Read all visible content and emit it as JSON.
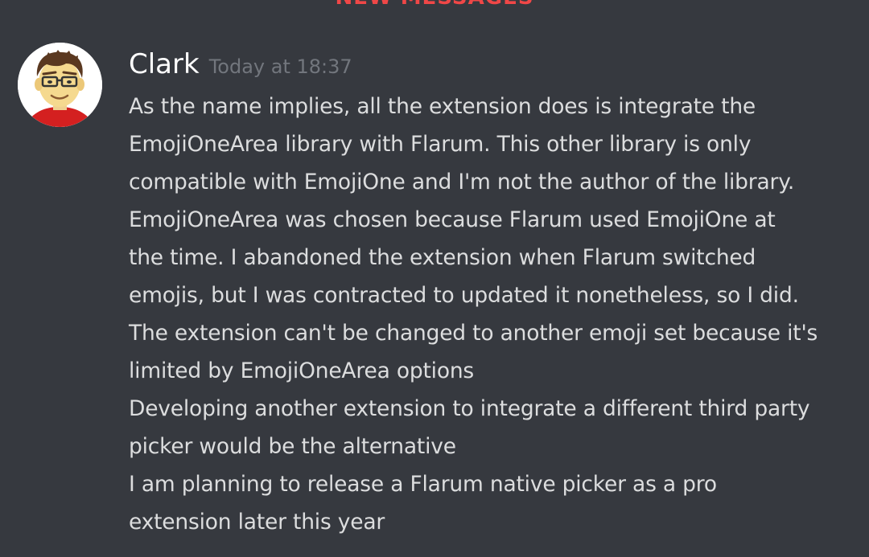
{
  "divider": {
    "label": "NEW MESSAGES",
    "color": "#f04747"
  },
  "message": {
    "author": "Clark",
    "timestamp": "Today at 18:37",
    "avatar_icon": "cartoon-man-with-glasses-avatar",
    "lines": [
      "As the name implies, all the extension does is integrate the",
      "EmojiOneArea library with Flarum. This other library is only",
      "compatible with EmojiOne and I'm not the author of the library.",
      "EmojiOneArea was chosen because Flarum used EmojiOne at",
      "the time. I abandoned the extension when Flarum switched",
      "emojis, but I was contracted to updated it nonetheless, so I did.",
      "The extension can't be changed to another emoji set because it's",
      "limited by EmojiOneArea options",
      "Developing another extension to integrate a different third party",
      "picker would be the alternative",
      "I am planning to release a Flarum native picker as a pro",
      "extension later this year"
    ]
  },
  "colors": {
    "background": "#36393f",
    "username": "#ffffff",
    "timestamp": "#72767d",
    "message_text": "#dcddde"
  }
}
